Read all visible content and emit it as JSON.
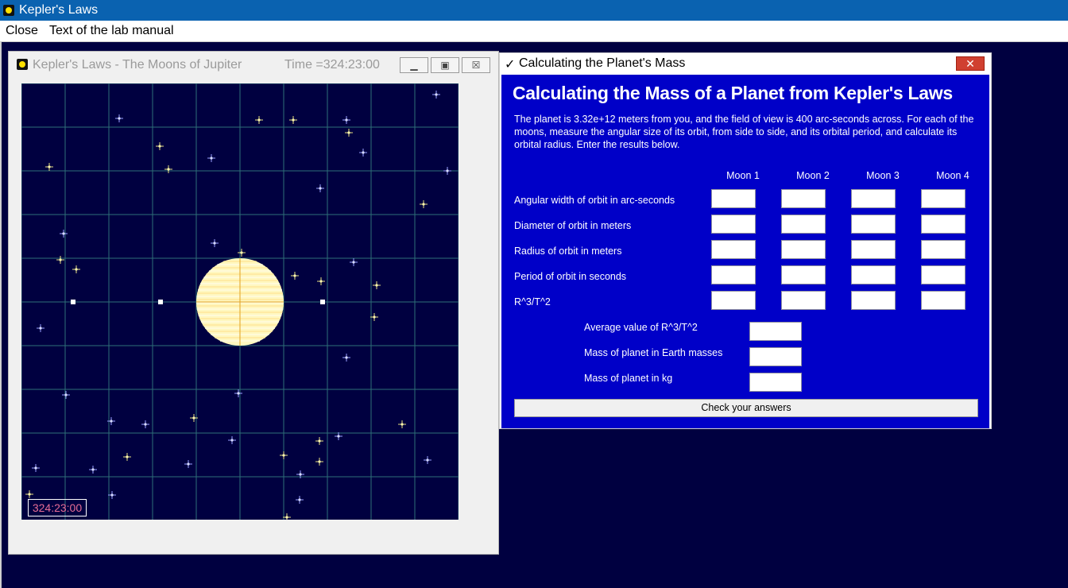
{
  "app": {
    "title": "Kepler's Laws"
  },
  "menu": {
    "items": [
      "Close",
      "Text of the lab manual"
    ]
  },
  "sim_window": {
    "title": "Kepler's Laws - The Moons of Jupiter",
    "time_label": "Time =324:23:00",
    "overlay_time": "324:23:00",
    "colors": {
      "background": "#000040",
      "grid": "#2e6f77",
      "planet": "#fff7c0",
      "planet_line": "#e0a020",
      "moon": "#ffffff",
      "star_yellow": "#e8e080",
      "star_blue": "#9aa0ff",
      "time_text": "#e86d95"
    }
  },
  "calc_window": {
    "title": "Calculating the Planet's Mass",
    "heading": "Calculating the Mass of a Planet from Kepler's Laws",
    "intro": "The planet is 3.32e+12 meters from you, and the field of view is 400 arc-seconds across. For each of the moons, measure the angular size of its orbit, from side to side, and its orbital period, and calculate its orbital radius. Enter the results below.",
    "columns": [
      "Moon 1",
      "Moon 2",
      "Moon 3",
      "Moon 4"
    ],
    "rows": [
      "Angular width of orbit in arc-seconds",
      "Diameter of orbit in meters",
      "Radius of orbit in meters",
      "Period of orbit in seconds",
      "R^3/T^2"
    ],
    "summary": [
      "Average value of R^3/T^2",
      "Mass of planet in Earth masses",
      "Mass of planet in kg"
    ],
    "check_button": "Check your answers",
    "colors": {
      "panel": "#0000c8",
      "close": "#d04030"
    }
  }
}
